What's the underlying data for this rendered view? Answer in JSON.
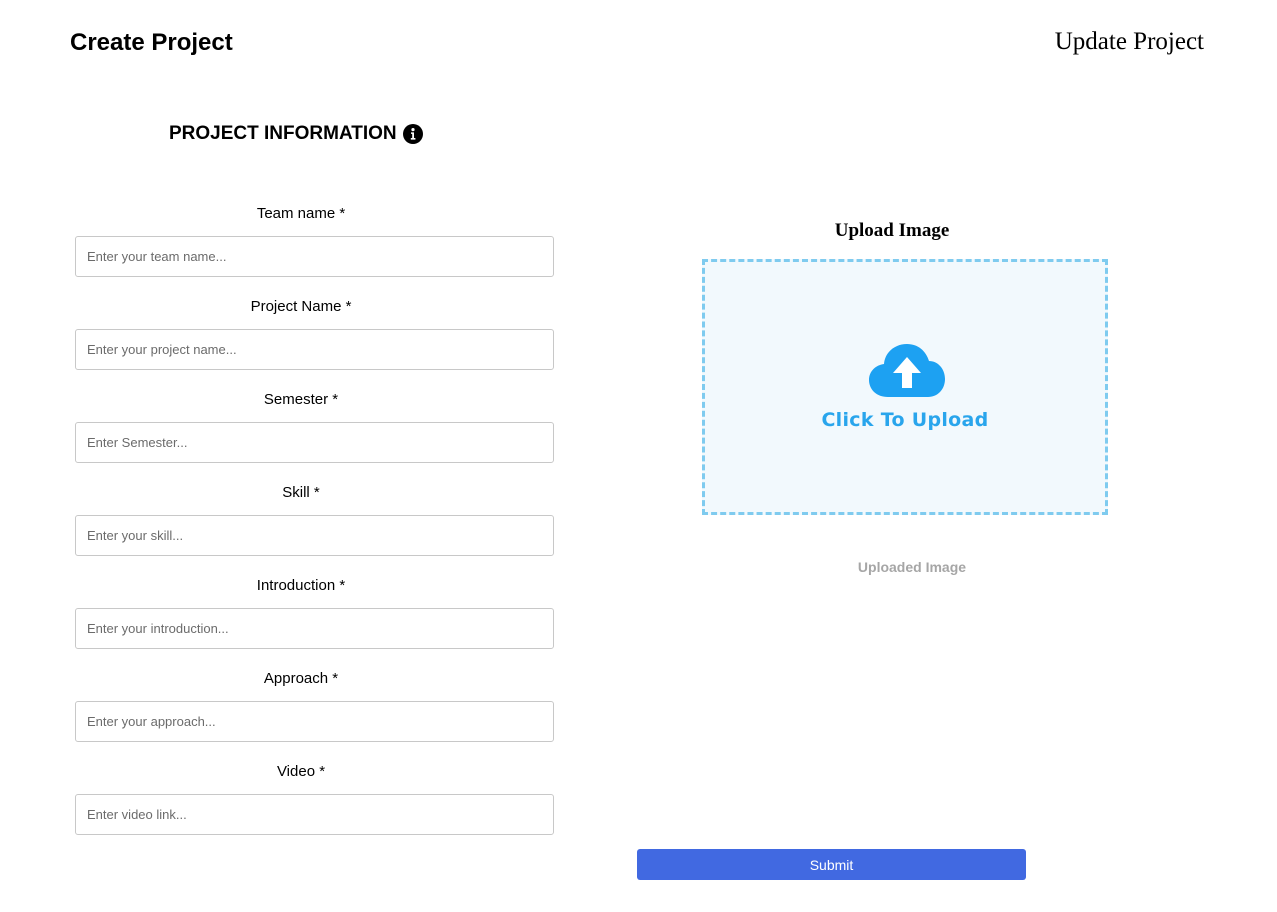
{
  "header": {
    "create_title": "Create Project",
    "update_link": "Update Project"
  },
  "section": {
    "title": "PROJECT INFORMATION",
    "info_icon": "info-circle-icon"
  },
  "fields": [
    {
      "label": "Team name *",
      "placeholder": "Enter your team name...",
      "value": ""
    },
    {
      "label": "Project Name *",
      "placeholder": "Enter your project name...",
      "value": ""
    },
    {
      "label": "Semester *",
      "placeholder": "Enter Semester...",
      "value": ""
    },
    {
      "label": "Skill *",
      "placeholder": "Enter your skill...",
      "value": ""
    },
    {
      "label": "Introduction *",
      "placeholder": "Enter your introduction...",
      "value": ""
    },
    {
      "label": "Approach *",
      "placeholder": "Enter your approach...",
      "value": ""
    },
    {
      "label": "Video *",
      "placeholder": "Enter video link...",
      "value": ""
    }
  ],
  "upload": {
    "title": "Upload Image",
    "dropzone_text": "Click To Upload",
    "icon": "cloud-upload-icon",
    "uploaded_label": "Uploaded Image"
  },
  "submit": {
    "label": "Submit"
  },
  "colors": {
    "accent": "#4169e1",
    "upload_blue": "#29a5ec",
    "dropzone_border": "#7fcbef",
    "dropzone_bg": "#f2f9fd"
  }
}
